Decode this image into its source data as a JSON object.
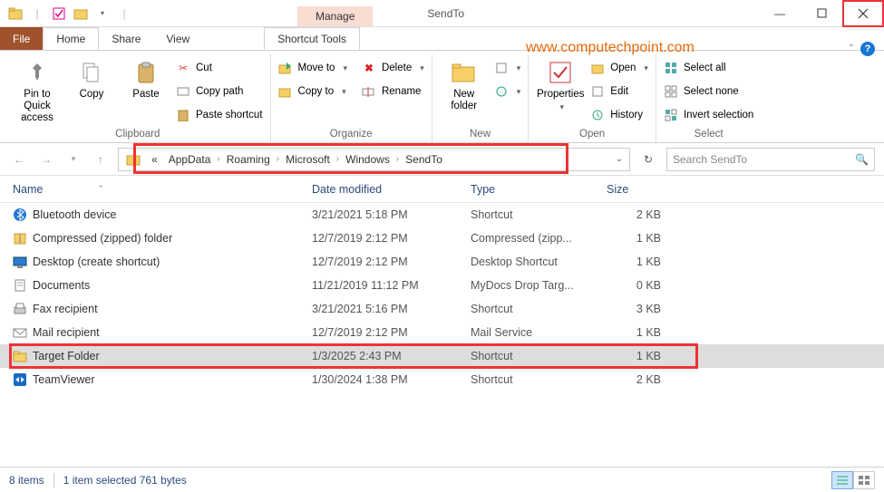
{
  "title": {
    "manage_tab": "Manage",
    "tools_tab": "Shortcut Tools",
    "window_title": "SendTo"
  },
  "watermark": "www.computechpoint.com",
  "ribbon_tabs": {
    "file": "File",
    "home": "Home",
    "share": "Share",
    "view": "View"
  },
  "ribbon": {
    "clipboard": {
      "label": "Clipboard",
      "pin": "Pin to Quick\naccess",
      "copy": "Copy",
      "paste": "Paste",
      "cut": "Cut",
      "copy_path": "Copy path",
      "paste_shortcut": "Paste shortcut"
    },
    "organize": {
      "label": "Organize",
      "move_to": "Move to",
      "copy_to": "Copy to",
      "delete": "Delete",
      "rename": "Rename"
    },
    "new": {
      "label": "New",
      "new_folder": "New\nfolder"
    },
    "open": {
      "label": "Open",
      "properties": "Properties",
      "open": "Open",
      "edit": "Edit",
      "history": "History"
    },
    "select": {
      "label": "Select",
      "all": "Select all",
      "none": "Select none",
      "invert": "Invert selection"
    }
  },
  "breadcrumb": {
    "parts": [
      "AppData",
      "Roaming",
      "Microsoft",
      "Windows",
      "SendTo"
    ]
  },
  "search": {
    "placeholder": "Search SendTo"
  },
  "columns": {
    "name": "Name",
    "date": "Date modified",
    "type": "Type",
    "size": "Size"
  },
  "files": [
    {
      "icon": "bluetooth",
      "name": "Bluetooth device",
      "date": "3/21/2021 5:18 PM",
      "type": "Shortcut",
      "size": "2 KB",
      "selected": false
    },
    {
      "icon": "zip",
      "name": "Compressed (zipped) folder",
      "date": "12/7/2019 2:12 PM",
      "type": "Compressed (zipp...",
      "size": "1 KB",
      "selected": false
    },
    {
      "icon": "desktop",
      "name": "Desktop (create shortcut)",
      "date": "12/7/2019 2:12 PM",
      "type": "Desktop Shortcut",
      "size": "1 KB",
      "selected": false
    },
    {
      "icon": "docs",
      "name": "Documents",
      "date": "11/21/2019 11:12 PM",
      "type": "MyDocs Drop Targ...",
      "size": "0 KB",
      "selected": false
    },
    {
      "icon": "fax",
      "name": "Fax recipient",
      "date": "3/21/2021 5:16 PM",
      "type": "Shortcut",
      "size": "3 KB",
      "selected": false
    },
    {
      "icon": "mail",
      "name": "Mail recipient",
      "date": "12/7/2019 2:12 PM",
      "type": "Mail Service",
      "size": "1 KB",
      "selected": false
    },
    {
      "icon": "folder",
      "name": "Target Folder",
      "date": "1/3/2025 2:43 PM",
      "type": "Shortcut",
      "size": "1 KB",
      "selected": true,
      "highlight": true
    },
    {
      "icon": "teamviewer",
      "name": "TeamViewer",
      "date": "1/30/2024 1:38 PM",
      "type": "Shortcut",
      "size": "2 KB",
      "selected": false
    }
  ],
  "status": {
    "items": "8 items",
    "selected": "1 item selected  761 bytes"
  }
}
